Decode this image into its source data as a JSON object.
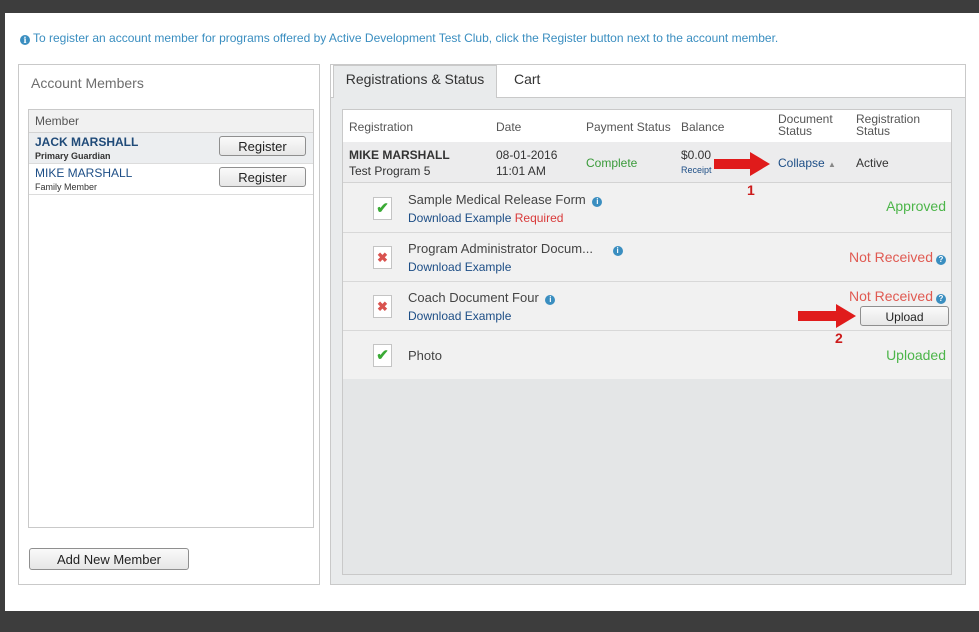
{
  "info": {
    "icon": "info-icon",
    "text": "To register an account member for programs offered by Active Development Test Club, click the Register button next to the account member."
  },
  "account_members": {
    "title": "Account Members",
    "column_header": "Member",
    "members": [
      {
        "name": "JACK MARSHALL",
        "role": "Primary Guardian",
        "button": "Register"
      },
      {
        "name": "MIKE MARSHALL",
        "role": "Family Member",
        "button": "Register"
      }
    ],
    "add_button": "Add New Member"
  },
  "tabs": [
    {
      "label": "Registrations & Status",
      "active": true
    },
    {
      "label": "Cart",
      "active": false
    }
  ],
  "table": {
    "headers": {
      "registration": "Registration",
      "date": "Date",
      "payment_status": "Payment Status",
      "balance": "Balance",
      "document_status_1": "Document",
      "document_status_2": "Status",
      "registration_status_1": "Registration",
      "registration_status_2": "Status"
    },
    "row": {
      "name": "MIKE MARSHALL",
      "program": "Test Program 5",
      "date": "08-01-2016",
      "time": "11:01 AM",
      "payment_status": "Complete",
      "balance": "$0.00",
      "receipt": "Receipt",
      "document_toggle": "Collapse",
      "registration_status": "Active"
    }
  },
  "documents": [
    {
      "title": "Sample Medical Release Form",
      "link": "Download Example",
      "required": "Required",
      "status": "Approved",
      "icon": "check-icon"
    },
    {
      "title": "Program Administrator Docum...",
      "link": "Download Example",
      "status": "Not Received",
      "icon": "x-icon"
    },
    {
      "title": "Coach Document Four",
      "link": "Download Example",
      "status": "Not Received",
      "button": "Upload",
      "icon": "x-icon"
    },
    {
      "title": "Photo",
      "status": "Uploaded",
      "icon": "check-icon"
    }
  ],
  "annotations": {
    "marker_1": "1",
    "marker_2": "2"
  },
  "colors": {
    "link_blue": "#1d4e86",
    "info_blue": "#3a8ec0",
    "success_green": "#4cb549",
    "error_red": "#e05a52",
    "annotation_red": "#cc1b1b"
  }
}
